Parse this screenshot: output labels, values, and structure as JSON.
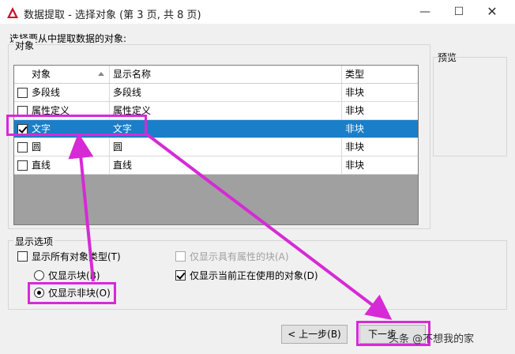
{
  "window": {
    "title": "数据提取 - 选择对象 (第 3 页, 共 8 页)",
    "minimize": "—",
    "maximize": "☐",
    "close": "✕"
  },
  "instruction": "选择要从中提取数据的对象:",
  "objects_group": {
    "legend": "对象",
    "columns": [
      "对象",
      "显示名称",
      "类型"
    ],
    "rows": [
      {
        "name": "多段线",
        "display": "多段线",
        "type": "非块",
        "checked": false,
        "selected": false
      },
      {
        "name": "属性定义",
        "display": "属性定义",
        "type": "非块",
        "checked": false,
        "selected": false
      },
      {
        "name": "文字",
        "display": "文字",
        "type": "非块",
        "checked": true,
        "selected": true
      },
      {
        "name": "圆",
        "display": "圆",
        "type": "非块",
        "checked": false,
        "selected": false
      },
      {
        "name": "直线",
        "display": "直线",
        "type": "非块",
        "checked": false,
        "selected": false
      }
    ]
  },
  "preview_group": {
    "legend": "预览"
  },
  "display_options": {
    "legend": "显示选项",
    "show_all_types": "显示所有对象类型(T)",
    "blocks_only": "仅显示块(B)",
    "non_blocks_only": "仅显示非块(O)",
    "blocks_with_attrs": "仅显示具有属性的块(A)",
    "in_use_only": "仅显示当前正在使用的对象(D)"
  },
  "buttons": {
    "back": "< 上一步(B)",
    "next": "下一步"
  },
  "watermark": "头条 @不想我的家",
  "colors": {
    "selection": "#1a7ec8",
    "highlight": "#d62ad6"
  }
}
